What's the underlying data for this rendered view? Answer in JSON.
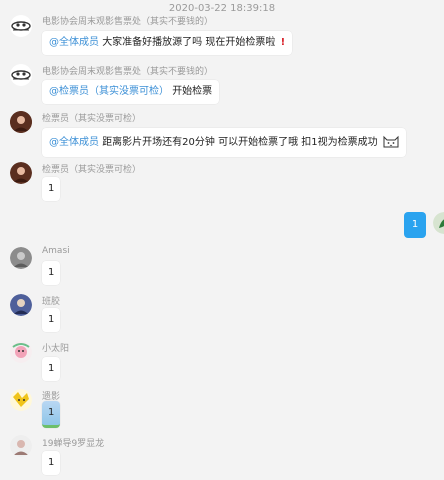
{
  "timestamp": "2020-03-22 18:39:18",
  "messages": [
    {
      "sender": "电影协会周末观影售票处（其实不要钱的）",
      "mention": "@全体成员",
      "text": "大家准备好播放源了吗 现在开始检票啦",
      "flag": "!"
    },
    {
      "sender": "电影协会周末观影售票处（其实不要钱的）",
      "mention": "@检票员（其实没票可检）",
      "text": "开始检票"
    },
    {
      "sender": "检票员（其实没票可检）",
      "mention": "@全体成员",
      "text": "距离影片开场还有20分钟 可以开始检票了哦 扣1视为检票成功"
    },
    {
      "sender": "检票员（其实没票可检）",
      "text": "1"
    },
    {
      "sender": "Amasi",
      "text": "1"
    },
    {
      "sender": "班胶",
      "text": "1"
    },
    {
      "sender": "小太阳",
      "text": "1"
    },
    {
      "sender": "遗影",
      "text": "1"
    },
    {
      "sender": "19蝉导9罗显龙",
      "text": "1"
    }
  ],
  "self_message": {
    "text": "1"
  },
  "colors": {
    "background": "#f3f3f3",
    "bubble": "#ffffff",
    "mention": "#3b8fd6",
    "self_bubble": "#2aa3ef",
    "alert": "#d9232c"
  }
}
